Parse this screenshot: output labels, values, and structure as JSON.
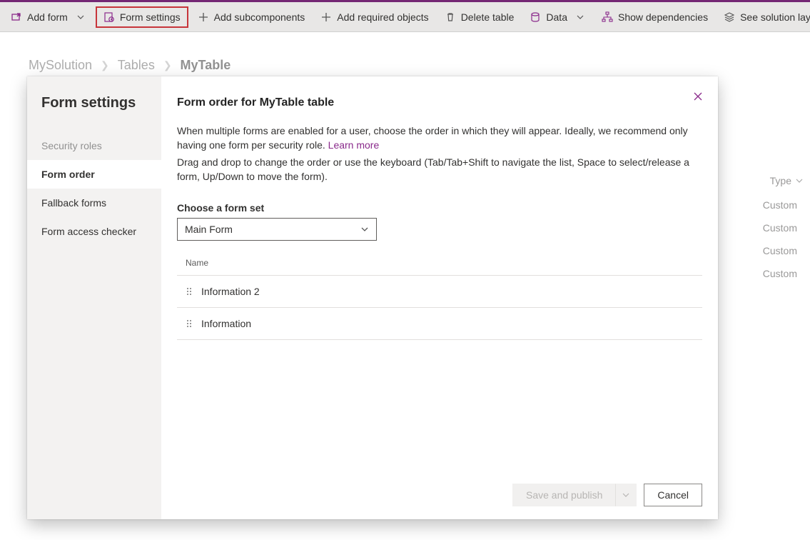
{
  "toolbar": {
    "add_form": "Add form",
    "form_settings": "Form settings",
    "add_subcomponents": "Add subcomponents",
    "add_required_objects": "Add required objects",
    "delete_table": "Delete table",
    "data": "Data",
    "show_dependencies": "Show dependencies",
    "see_solution_layers": "See solution layers"
  },
  "breadcrumb": {
    "root": "MySolution",
    "level1": "Tables",
    "current": "MyTable"
  },
  "bg_table": {
    "type_header": "Type",
    "rows": [
      "Custom",
      "Custom",
      "Custom",
      "Custom"
    ]
  },
  "panel": {
    "side_title": "Form settings",
    "side_items": {
      "security_roles": "Security roles",
      "form_order": "Form order",
      "fallback_forms": "Fallback forms",
      "form_access_checker": "Form access checker"
    },
    "heading": "Form order for MyTable table",
    "desc_part1": "When multiple forms are enabled for a user, choose the order in which they will appear. Ideally, we recommend only having one form per security role. ",
    "learn_more": "Learn more",
    "desc2": "Drag and drop to change the order or use the keyboard (Tab/Tab+Shift to navigate the list, Space to select/release a form, Up/Down to move the form).",
    "form_set_label": "Choose a form set",
    "form_set_value": "Main Form",
    "list_header": "Name",
    "rows": [
      "Information 2",
      "Information"
    ],
    "save_label": "Save and publish",
    "cancel_label": "Cancel"
  }
}
